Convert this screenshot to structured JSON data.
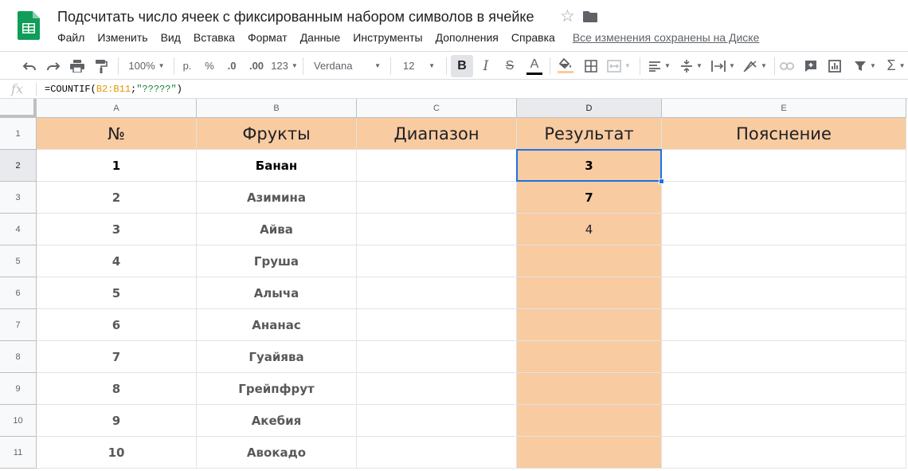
{
  "document": {
    "title": "Подсчитать число ячеек с фиксированным набором символов в ячейке",
    "save_status": "Все изменения сохранены на Диске"
  },
  "menu": [
    "Файл",
    "Изменить",
    "Вид",
    "Вставка",
    "Формат",
    "Данные",
    "Инструменты",
    "Дополнения",
    "Справка"
  ],
  "toolbar": {
    "zoom": "100%",
    "currency": "р.",
    "percent": "%",
    "decrease_decimal": ".0",
    "increase_decimal": ".00",
    "number_format": "123",
    "font": "Verdana",
    "font_size": "12",
    "bold": "B",
    "italic": "I",
    "strike": "S",
    "text_color": "A"
  },
  "formula_bar": {
    "fx": "fx",
    "prefix": "=COUNTIF(",
    "range": "B2:B11",
    "sep": ";",
    "criterion": "\"?????\"",
    "suffix": ")"
  },
  "columns": [
    "A",
    "B",
    "C",
    "D",
    "E"
  ],
  "rows": [
    "1",
    "2",
    "3",
    "4",
    "5",
    "6",
    "7",
    "8",
    "9",
    "10",
    "11"
  ],
  "header_row": [
    "№",
    "Фрукты",
    "Диапазон",
    "Результат",
    "Пояснение"
  ],
  "data_rows": [
    [
      "1",
      "Банан",
      "",
      "3",
      ""
    ],
    [
      "2",
      "Азимина",
      "",
      "7",
      ""
    ],
    [
      "3",
      "Айва",
      "",
      "4",
      ""
    ],
    [
      "4",
      "Груша",
      "",
      "",
      ""
    ],
    [
      "5",
      "Алыча",
      "",
      "",
      ""
    ],
    [
      "6",
      "Ананас",
      "",
      "",
      ""
    ],
    [
      "7",
      "Гуайява",
      "",
      "",
      ""
    ],
    [
      "8",
      "Грейпфрут",
      "",
      "",
      ""
    ],
    [
      "9",
      "Акебия",
      "",
      "",
      ""
    ],
    [
      "10",
      "Авокадо",
      "",
      "",
      ""
    ]
  ],
  "colors": {
    "header_fill": "#f8cba1",
    "selection": "#1a73e8",
    "sheets_green": "#0f9d58"
  },
  "active_cell": "D2"
}
